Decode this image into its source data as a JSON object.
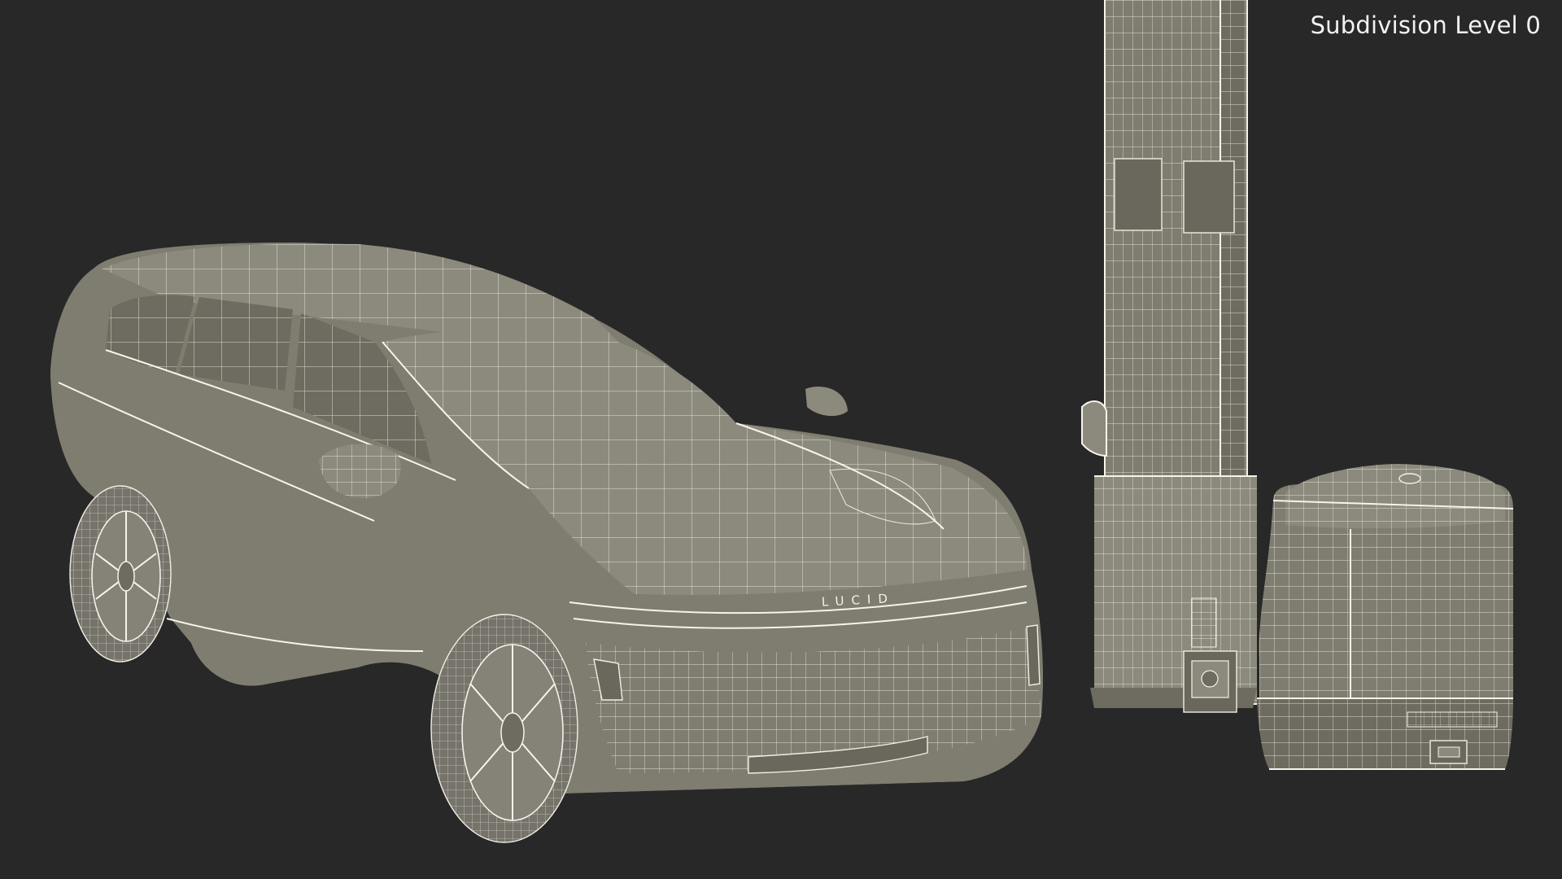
{
  "viewport": {
    "overlay_label": "Subdivision Level 0",
    "background_color": "#282828",
    "model_color": "#7f7d70",
    "wire_color": "#f1efe6"
  },
  "car": {
    "badge_text": "LUCID"
  }
}
